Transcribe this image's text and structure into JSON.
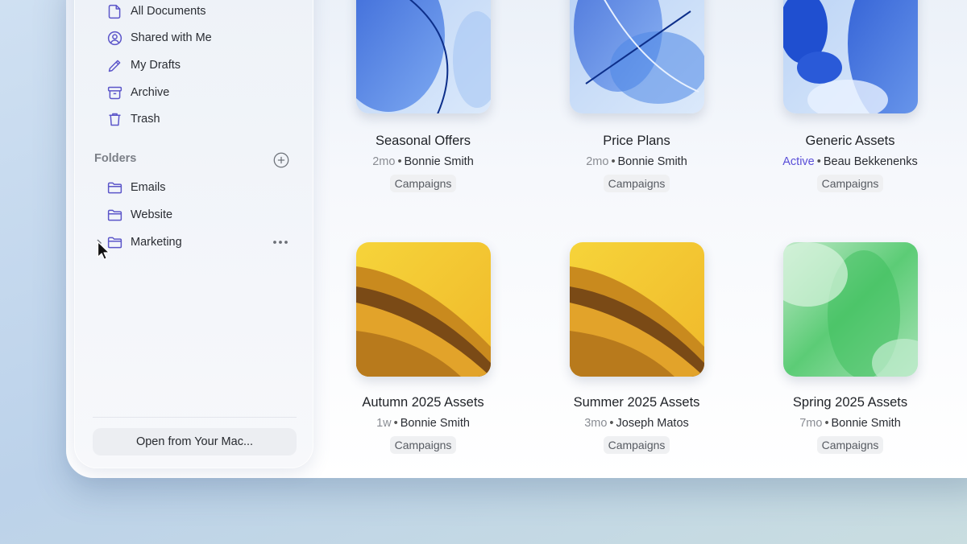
{
  "sidebar": {
    "items": [
      {
        "label": "All Documents",
        "icon": "document-icon"
      },
      {
        "label": "Shared with Me",
        "icon": "person-circle-icon"
      },
      {
        "label": "My Drafts",
        "icon": "pencil-icon"
      },
      {
        "label": "Archive",
        "icon": "archive-box-icon"
      },
      {
        "label": "Trash",
        "icon": "trash-icon"
      }
    ],
    "folders_heading": "Folders",
    "folders": [
      {
        "label": "Emails",
        "icon": "folder-icon"
      },
      {
        "label": "Website",
        "icon": "folder-icon"
      },
      {
        "label": "Marketing",
        "icon": "folder-icon"
      }
    ],
    "open_button": "Open from Your Mac..."
  },
  "documents": [
    {
      "title": "Seasonal Offers",
      "time": "2mo",
      "owner": "Bonnie Smith",
      "tag": "Campaigns",
      "thumb": "blue"
    },
    {
      "title": "Price Plans",
      "time": "2mo",
      "owner": "Bonnie Smith",
      "tag": "Campaigns",
      "thumb": "blue"
    },
    {
      "title": "Generic Assets",
      "time": "Active",
      "owner": "Beau Bekkenenks",
      "tag": "Campaigns",
      "thumb": "blue"
    },
    {
      "title": "Autumn 2025 Assets",
      "time": "1w",
      "owner": "Bonnie Smith",
      "tag": "Campaigns",
      "thumb": "yellow"
    },
    {
      "title": "Summer 2025 Assets",
      "time": "3mo",
      "owner": "Joseph Matos",
      "tag": "Campaigns",
      "thumb": "yellow"
    },
    {
      "title": "Spring 2025 Assets",
      "time": "7mo",
      "owner": "Bonnie Smith",
      "tag": "Campaigns",
      "thumb": "green"
    }
  ],
  "colors": {
    "accent": "#5a4fd8",
    "icon": "#5b55c9",
    "active_status": "#5a4fd8"
  }
}
